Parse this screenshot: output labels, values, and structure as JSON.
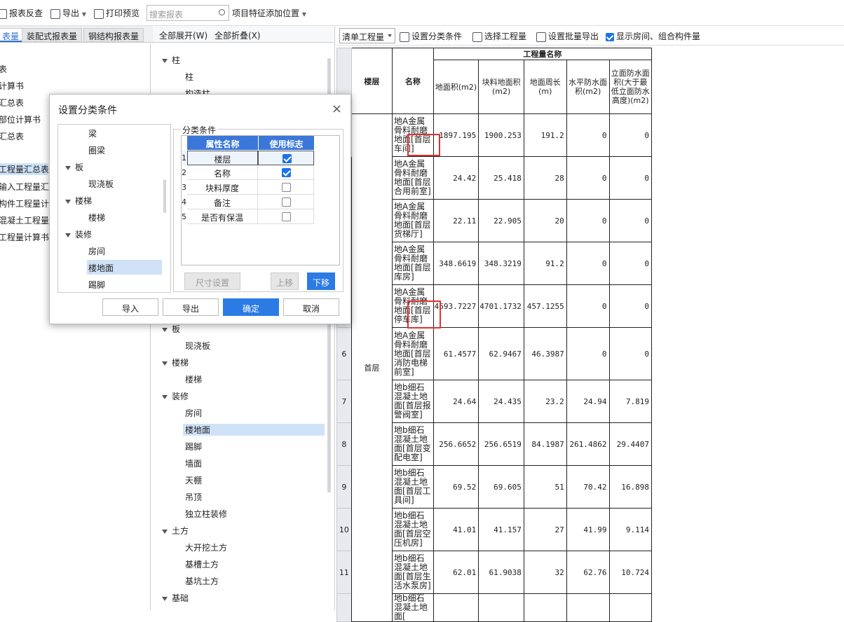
{
  "toolbar": {
    "report_check": "报表反查",
    "export": "导出",
    "print_preview": "打印预览",
    "search_placeholder": "搜索报表",
    "item_feature": "项目特征添加位置"
  },
  "left_tabs": [
    "表量",
    "装配式报表量",
    "钢结构报表量"
  ],
  "left_items": [
    "表",
    "计算书",
    "汇总表",
    "部位计算书",
    "汇总表",
    "工程量汇总表",
    "输入工程量汇总",
    "构件工程量计算",
    "混凝土工程量汇",
    "工程量计算书"
  ],
  "mid": {
    "expand_all": "全部展开(W)",
    "collapse_all": "全部折叠(X)",
    "top_items": [
      {
        "label": "柱",
        "group": true
      },
      {
        "label": "柱",
        "group": false
      },
      {
        "label": "构造柱",
        "group": false
      }
    ],
    "items": [
      {
        "label": "板",
        "group": true
      },
      {
        "label": "现浇板",
        "group": false
      },
      {
        "label": "楼梯",
        "group": true
      },
      {
        "label": "楼梯",
        "group": false
      },
      {
        "label": "装修",
        "group": true
      },
      {
        "label": "房间",
        "group": false
      },
      {
        "label": "楼地面",
        "group": false
      },
      {
        "label": "踢脚",
        "group": false
      },
      {
        "label": "墙面",
        "group": false
      },
      {
        "label": "天棚",
        "group": false
      },
      {
        "label": "吊顶",
        "group": false
      },
      {
        "label": "独立柱装修",
        "group": false
      },
      {
        "label": "土方",
        "group": true
      },
      {
        "label": "大开挖土方",
        "group": false
      },
      {
        "label": "基槽土方",
        "group": false
      },
      {
        "label": "基坑土方",
        "group": false
      },
      {
        "label": "基础",
        "group": true
      }
    ]
  },
  "right_toolbar": {
    "combo": "清单工程量",
    "set_class": "设置分类条件",
    "select_qty": "选择工程量",
    "batch_export": "设置批量导出",
    "show_rooms": "显示房间、组合构件量"
  },
  "grid": {
    "h_floor": "楼层",
    "h_name": "名称",
    "h_group": "工程量名称",
    "h_cols": [
      "地面积(m2)",
      "块料地面积(m2)",
      "地面周长(m)",
      "水平防水面积(m2)",
      "立面防水面积(大于最低立面防水高度)(m2)"
    ],
    "floor_value": "首层",
    "rows": [
      {
        "n": "",
        "name": "地A金属骨料耐磨地面[首层车间]",
        "v": [
          "1897.195",
          "1900.253",
          "191.2",
          "0",
          "0"
        ]
      },
      {
        "n": "",
        "name": "地A金属骨料耐磨地面[首层合用前室]",
        "v": [
          "24.42",
          "25.418",
          "28",
          "0",
          "0"
        ]
      },
      {
        "n": "",
        "name": "地A金属骨料耐磨地面[首层货梯厅]",
        "v": [
          "22.11",
          "22.905",
          "20",
          "0",
          "0"
        ]
      },
      {
        "n": "",
        "name": "地A金属骨料耐磨地面[首层库房]",
        "v": [
          "348.6619",
          "348.3219",
          "91.2",
          "0",
          "0"
        ]
      },
      {
        "n": "",
        "name": "地A金属骨料耐磨地面[首层停车库]",
        "v": [
          "4693.7227",
          "4701.1732",
          "457.1255",
          "0",
          "0"
        ]
      },
      {
        "n": "6",
        "name": "地A金属骨料耐磨地面[首层消防电梯前室]",
        "v": [
          "61.4577",
          "62.9467",
          "46.3987",
          "0",
          "0"
        ]
      },
      {
        "n": "7",
        "name": "地b细石混凝土地面[首层报警阀室]",
        "v": [
          "24.64",
          "24.435",
          "23.2",
          "24.94",
          "7.819"
        ]
      },
      {
        "n": "8",
        "name": "地b细石混凝土地面[首层变配电室]",
        "v": [
          "256.6652",
          "256.6519",
          "84.1987",
          "261.4862",
          "29.4407"
        ]
      },
      {
        "n": "9",
        "name": "地b细石混凝土地面[首层工具间]",
        "v": [
          "69.52",
          "69.605",
          "51",
          "70.42",
          "16.898"
        ]
      },
      {
        "n": "10",
        "name": "地b细石混凝土地面[首层空压机房]",
        "v": [
          "41.01",
          "41.157",
          "27",
          "41.99",
          "9.114"
        ]
      },
      {
        "n": "11",
        "name": "地b细石混凝土地面[首层生活水泵房]",
        "v": [
          "62.01",
          "61.9038",
          "32",
          "62.76",
          "10.724"
        ]
      },
      {
        "n": "",
        "name": "地b细石混凝土地面[",
        "v": [
          "",
          "",
          "",
          "",
          ""
        ]
      }
    ]
  },
  "dialog": {
    "title": "设置分类条件",
    "close": "×",
    "tree": [
      {
        "label": "梁",
        "group": false
      },
      {
        "label": "圈梁",
        "group": false
      },
      {
        "label": "板",
        "group": true
      },
      {
        "label": "现浇板",
        "group": false
      },
      {
        "label": "楼梯",
        "group": true
      },
      {
        "label": "楼梯",
        "group": false
      },
      {
        "label": "装修",
        "group": true
      },
      {
        "label": "房间",
        "group": false
      },
      {
        "label": "楼地面",
        "group": false
      },
      {
        "label": "踢脚",
        "group": false
      }
    ],
    "group_label": "分类条件",
    "col_name": "属性名称",
    "col_use": "使用标志",
    "props": [
      {
        "idx": "1",
        "name": "楼层",
        "on": true
      },
      {
        "idx": "2",
        "name": "名称",
        "on": true
      },
      {
        "idx": "3",
        "name": "块料厚度",
        "on": false
      },
      {
        "idx": "4",
        "name": "备注",
        "on": false
      },
      {
        "idx": "5",
        "name": "是否有保温",
        "on": false
      }
    ],
    "btn_size": "尺寸设置",
    "btn_up": "上移",
    "btn_down": "下移",
    "btn_import": "导入",
    "btn_export": "导出",
    "btn_ok": "确定",
    "btn_cancel": "取消"
  },
  "colors": {
    "accent": "#2c7be5",
    "highlight": "#e03030",
    "selection": "#cfe2f8"
  }
}
